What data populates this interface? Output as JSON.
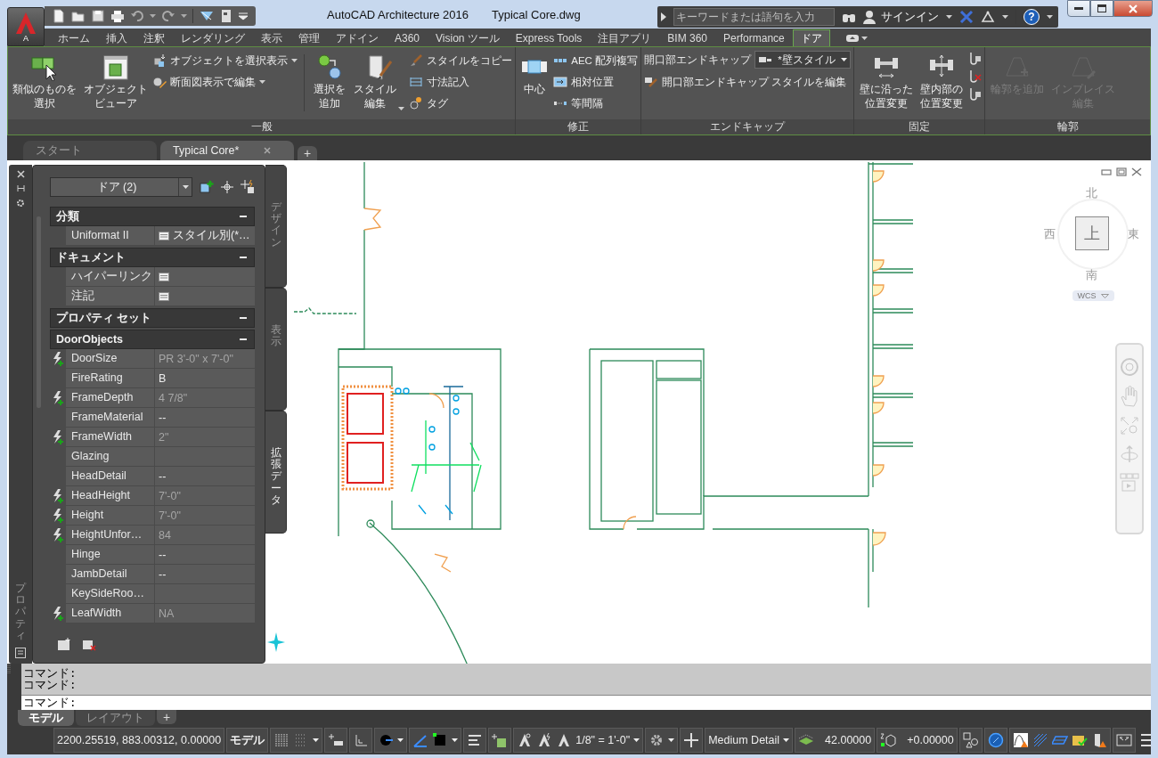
{
  "window": {
    "title": "AutoCAD Architecture 2016",
    "document": "Typical Core.dwg"
  },
  "app_button": {
    "label": "A"
  },
  "search": {
    "placeholder": "キーワードまたは語句を入力"
  },
  "sign_in": {
    "label": "サインイン"
  },
  "help": {
    "label": "?"
  },
  "ribbon_tabs": [
    {
      "label": "ホーム",
      "selected": false
    },
    {
      "label": "挿入",
      "selected": false
    },
    {
      "label": "注釈",
      "selected": false
    },
    {
      "label": "レンダリング",
      "selected": false
    },
    {
      "label": "表示",
      "selected": false
    },
    {
      "label": "管理",
      "selected": false
    },
    {
      "label": "アドイン",
      "selected": false
    },
    {
      "label": "A360",
      "selected": false
    },
    {
      "label": "Vision ツール",
      "selected": false
    },
    {
      "label": "Express Tools",
      "selected": false
    },
    {
      "label": "注目アプリ",
      "selected": false
    },
    {
      "label": "BIM 360",
      "selected": false
    },
    {
      "label": "Performance",
      "selected": false
    },
    {
      "label": "ドア",
      "selected": true
    }
  ],
  "ribbon_panels": [
    {
      "title": "一般",
      "items": [
        {
          "kind": "large",
          "label": "類似のものを選択",
          "caret": false,
          "disabled": false
        },
        {
          "kind": "large",
          "label": "オブジェクトビューア",
          "caret": false,
          "disabled": false
        },
        {
          "kind": "stack",
          "items": [
            {
              "label": "オブジェクトを選択表示",
              "caret": true
            },
            {
              "label": "断面図表示で編集",
              "caret": true
            }
          ]
        },
        {
          "kind": "separator"
        },
        {
          "kind": "large",
          "label": "選択を追加",
          "caret": false,
          "disabled": false
        },
        {
          "kind": "large",
          "label": "スタイル編集",
          "caret": true,
          "disabled": false
        },
        {
          "kind": "stack",
          "items": [
            {
              "label": "スタイルをコピー",
              "caret": false
            },
            {
              "label": "寸法記入",
              "caret": false
            },
            {
              "label": "タグ",
              "caret": false
            }
          ]
        }
      ]
    },
    {
      "title": "修正",
      "items": [
        {
          "kind": "large",
          "label": "中心",
          "caret": false,
          "disabled": false
        },
        {
          "kind": "stack",
          "items": [
            {
              "label": "AEC 配列複写",
              "caret": false
            },
            {
              "label": "相対位置",
              "caret": false
            },
            {
              "label": "等間隔",
              "caret": false
            }
          ]
        }
      ]
    },
    {
      "title": "エンドキャップ",
      "items": [
        {
          "kind": "endcap",
          "label": "開口部エンドキャップ",
          "value": "*壁スタイル",
          "edit_label": "開口部エンドキャップ スタイルを編集"
        }
      ]
    },
    {
      "title": "固定",
      "items": [
        {
          "kind": "large",
          "label": "壁に沿った位置変更",
          "caret": false,
          "disabled": false
        },
        {
          "kind": "large",
          "label": "壁内部の位置変更",
          "caret": false,
          "disabled": false
        },
        {
          "kind": "icon-stack"
        }
      ]
    },
    {
      "title": "輪郭",
      "items": [
        {
          "kind": "large",
          "label": "輪郭を追加",
          "caret": false,
          "disabled": true
        },
        {
          "kind": "large",
          "label": "インプレイス編集",
          "caret": false,
          "disabled": true
        }
      ]
    }
  ],
  "file_tabs": [
    {
      "label": "スタート",
      "selected": false
    },
    {
      "label": "Typical Core*",
      "selected": true
    }
  ],
  "new_tab": {
    "label": "+"
  },
  "properties": {
    "title": "プロパティ",
    "selector": "ドア (2)",
    "sections": [
      {
        "title": "分類",
        "expanded": true,
        "rows": [
          {
            "name": "Uniformat II",
            "kind": "list",
            "value": "スタイル別(*…",
            "auto": false
          }
        ]
      },
      {
        "title": "ドキュメント",
        "expanded": true,
        "rows": [
          {
            "name": "ハイパーリンク",
            "kind": "list",
            "auto": false
          },
          {
            "name": "注記",
            "kind": "list",
            "auto": false
          }
        ]
      },
      {
        "title": "プロパティ セット",
        "expanded": true
      },
      {
        "title": "DoorObjects",
        "expanded": true,
        "rows": [
          {
            "name": "DoorSize",
            "kind": "text",
            "value": "PR 3'-0\" x 7'-0\"",
            "auto": true
          },
          {
            "name": "FireRating",
            "kind": "text",
            "value": "B",
            "auto": false
          },
          {
            "name": "FrameDepth",
            "kind": "text",
            "value": "4 7/8\"",
            "auto": true
          },
          {
            "name": "FrameMaterial",
            "kind": "text",
            "value": "--",
            "auto": false
          },
          {
            "name": "FrameWidth",
            "kind": "text",
            "value": "2\"",
            "auto": true
          },
          {
            "name": "Glazing",
            "kind": "text",
            "auto": false
          },
          {
            "name": "HeadDetail",
            "kind": "text",
            "value": "--",
            "auto": false
          },
          {
            "name": "HeadHeight",
            "kind": "text",
            "value": "7'-0\"",
            "auto": true
          },
          {
            "name": "Height",
            "kind": "text",
            "value": "7'-0\"",
            "auto": true
          },
          {
            "name": "HeightUnfor…",
            "kind": "text",
            "value": "84",
            "auto": true
          },
          {
            "name": "Hinge",
            "kind": "text",
            "value": "--",
            "auto": false
          },
          {
            "name": "JambDetail",
            "kind": "text",
            "value": "--",
            "auto": false
          },
          {
            "name": "KeySideRoo…",
            "kind": "text",
            "auto": false
          },
          {
            "name": "LeafWidth",
            "kind": "text",
            "value": "NA",
            "auto": true
          }
        ]
      }
    ],
    "side_tabs": [
      {
        "label": "デザイン",
        "selected": false
      },
      {
        "label": "表示",
        "selected": false
      },
      {
        "label": "拡張データ",
        "selected": true
      }
    ]
  },
  "viewcube": {
    "top": "上",
    "north": "北",
    "east": "東",
    "south": "南",
    "west": "西",
    "ucs": "WCS"
  },
  "command": {
    "history": [
      "コマンド:",
      "コマンド:"
    ],
    "prompt": "コマンド:"
  },
  "layout_tabs": [
    {
      "label": "モデル",
      "selected": true
    },
    {
      "label": "レイアウト",
      "selected": false
    }
  ],
  "new_layout": {
    "label": "+"
  },
  "status_bar": {
    "coordinates": "2200.25519, 883.00312, 0.00000",
    "space": "モデル",
    "scale": "1/8\" = 1'-0\"",
    "detail": "Medium Detail",
    "elevation": "42.00000",
    "offset": "+0.00000"
  }
}
